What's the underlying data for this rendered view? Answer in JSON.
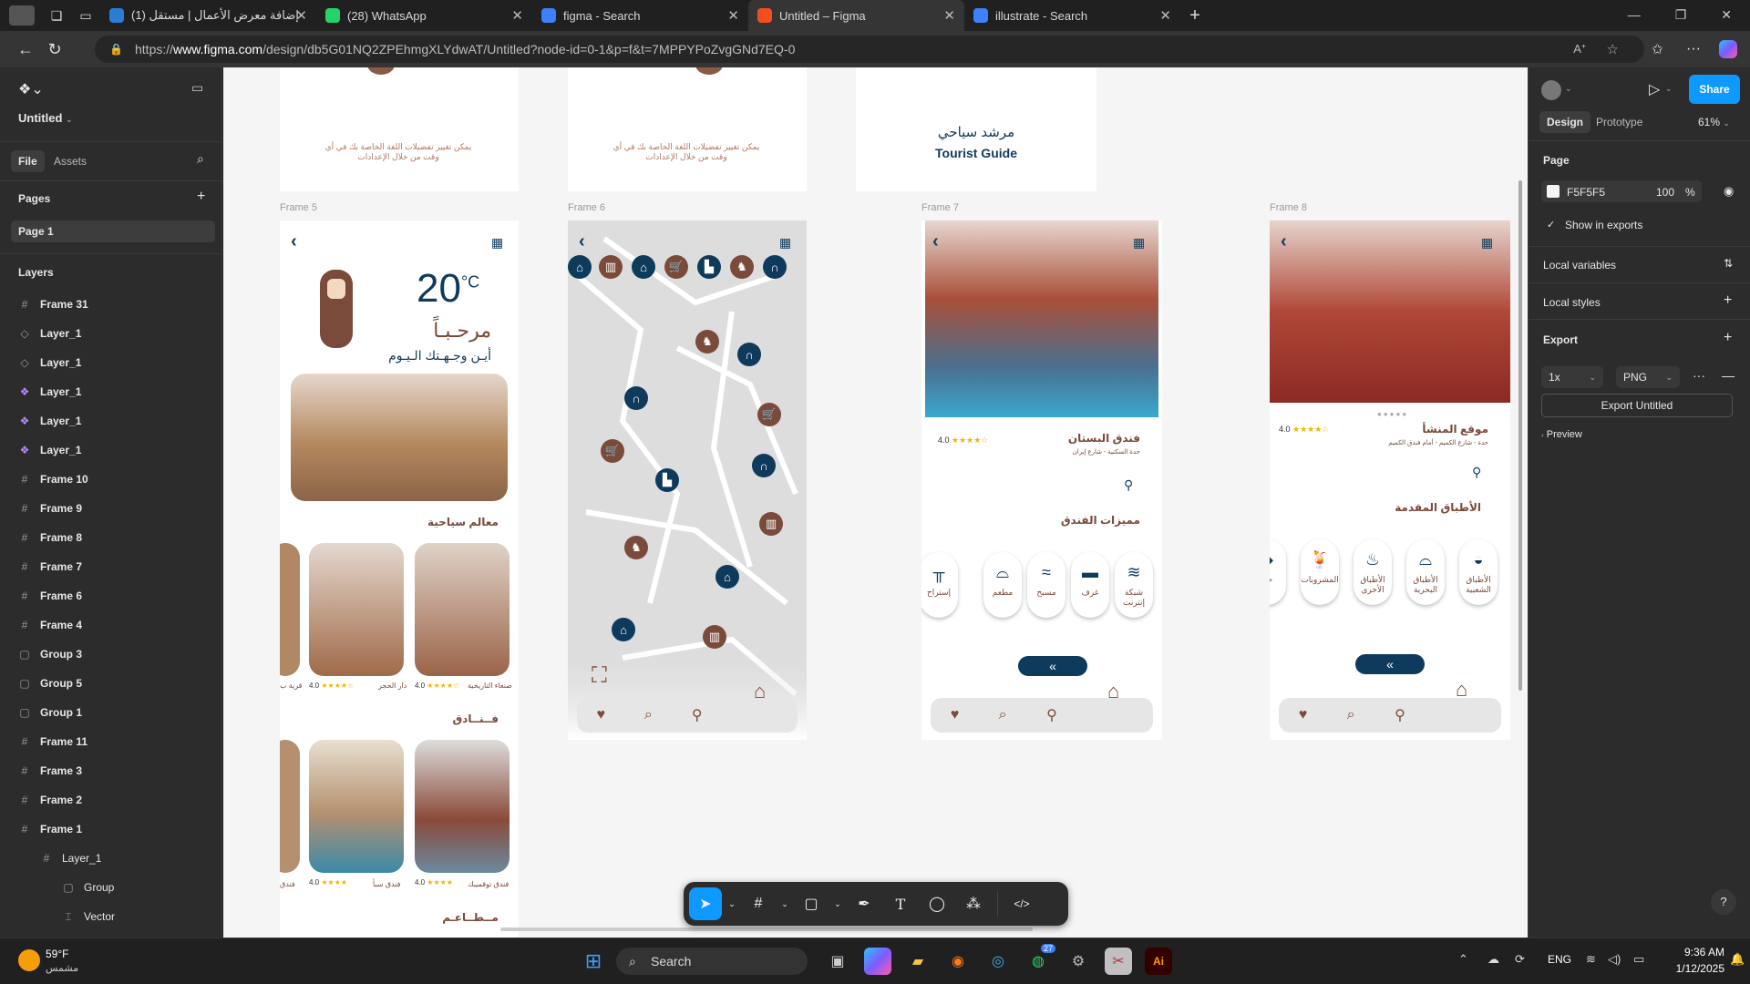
{
  "browser": {
    "tabs": [
      {
        "title": "(1) إضافة معرض الأعمال | مستقل",
        "color": "#2b7cd3"
      },
      {
        "title": "(28) WhatsApp",
        "color": "#25d366"
      },
      {
        "title": "figma - Search",
        "color": "#3b82f6"
      },
      {
        "title": "Untitled – Figma",
        "color": "#f24e1e"
      },
      {
        "title": "illustrate - Search",
        "color": "#3b82f6"
      }
    ],
    "url_prefix": "https://",
    "url_host": "www.figma.com",
    "url_path": "/design/db5G01NQ2ZPEhmgXLYdwAT/Untitled?node-id=0-1&p=f&t=7MPPYPoZvgGNd7EQ-0"
  },
  "left": {
    "file_title": "Untitled",
    "tab_file": "File",
    "tab_assets": "Assets",
    "pages_header": "Pages",
    "page": "Page 1",
    "layers_header": "Layers",
    "layers": [
      {
        "name": "Frame 31",
        "icon": "#"
      },
      {
        "name": "Layer_1",
        "icon": "◇"
      },
      {
        "name": "Layer_1",
        "icon": "◇"
      },
      {
        "name": "Layer_1",
        "icon": "❖"
      },
      {
        "name": "Layer_1",
        "icon": "❖"
      },
      {
        "name": "Layer_1",
        "icon": "❖"
      },
      {
        "name": "Frame 10",
        "icon": "#"
      },
      {
        "name": "Frame 9",
        "icon": "#"
      },
      {
        "name": "Frame 8",
        "icon": "#"
      },
      {
        "name": "Frame 7",
        "icon": "#"
      },
      {
        "name": "Frame 6",
        "icon": "#"
      },
      {
        "name": "Frame 4",
        "icon": "#"
      },
      {
        "name": "Group 3",
        "icon": "▢"
      },
      {
        "name": "Group 5",
        "icon": "▢"
      },
      {
        "name": "Group 1",
        "icon": "▢"
      },
      {
        "name": "Frame 11",
        "icon": "#"
      },
      {
        "name": "Frame 3",
        "icon": "#"
      },
      {
        "name": "Frame 2",
        "icon": "#"
      },
      {
        "name": "Frame 1",
        "icon": "#"
      },
      {
        "name": "Layer_1",
        "icon": "#"
      },
      {
        "name": "Group",
        "icon": "▢"
      },
      {
        "name": "Vector",
        "icon": "⌶"
      }
    ]
  },
  "right": {
    "share": "Share",
    "tab_design": "Design",
    "tab_prototype": "Prototype",
    "zoom": "61%",
    "page_header": "Page",
    "page_color": "F5F5F5",
    "page_opacity": "100",
    "percent": "%",
    "show_exports": "Show in exports",
    "local_variables": "Local variables",
    "local_styles": "Local styles",
    "export": "Export",
    "scale": "1x",
    "format": "PNG",
    "export_button": "Export Untitled",
    "preview": "Preview"
  },
  "canvas": {
    "frame_labels": [
      "Frame 5",
      "Frame 6",
      "Frame 7",
      "Frame 8"
    ],
    "top_text_ar": "يمكن تغيير تفضيلات اللغة الخاصة بك في أي وقت من خلال الإعدادات",
    "guide_ar": "مرشد سياحي",
    "guide_en": "Tourist Guide",
    "f5": {
      "temp": "20",
      "unit": "°C",
      "welcome": "مرحـبـاً",
      "where": "أيـن وجـهـتك الـيـوم",
      "landmarks": "معالم سياحية",
      "hotels": "فــنــادق",
      "restaurants": "مــطــاعـم",
      "card1": "صنعاء التاريخية",
      "card2": "دار الحجر",
      "card3": "قرية ب",
      "hotel1": "فندق توقميبك",
      "hotel2": "فندق سبأ",
      "hotel3": "فندق",
      "rating": "4.0"
    },
    "f7": {
      "name": "فندق البستان",
      "addr": "حدة السكنية - شارع إيران",
      "rating": "4.0",
      "features": "مميزات الفندق",
      "amenities": [
        "شبكة إنترنت",
        "غرف",
        "مسبح",
        "مطعم",
        "إستراح"
      ]
    },
    "f8": {
      "name": "موقع المنشأ",
      "addr": "حدة - شارع الكميم - أمام فندق الكميم",
      "rating": "4.0",
      "dishes": "الأطباق المقدمة",
      "amenities": [
        "الأطباق الشعبية",
        "الأطباق البحرية",
        "الأطباق الأخرى",
        "المشروبات",
        "حل"
      ]
    }
  },
  "toolbar": {
    "code": "</>"
  },
  "taskbar": {
    "temp": "59°F",
    "weather": "مشمس",
    "search": "Search",
    "lang": "ENG",
    "time": "9:36 AM",
    "date": "1/12/2025",
    "wa_badge": "27"
  },
  "colors": {
    "navy": "#0e3b5c",
    "brown": "#7a4a3a",
    "figma_blue": "#0d99ff"
  }
}
